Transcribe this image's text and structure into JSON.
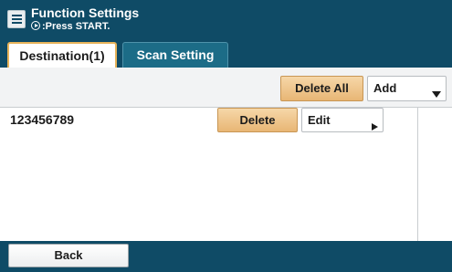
{
  "header": {
    "title": "Function Settings",
    "subtitle": ":Press START.",
    "menu_icon": "menu-icon",
    "start_icon": "start-icon"
  },
  "tabs": [
    {
      "label": "Destination(1)",
      "active": true
    },
    {
      "label": "Scan Setting",
      "active": false
    }
  ],
  "toolbar": {
    "delete_all_label": "Delete All",
    "add_label": "Add"
  },
  "list": {
    "rows": [
      {
        "number": "123456789",
        "delete_label": "Delete",
        "edit_label": "Edit"
      }
    ]
  },
  "footer": {
    "back_label": "Back"
  },
  "colors": {
    "header_bg": "#0f4b66",
    "accent_orange": "#e8b675",
    "tab_inactive": "#1c6c87"
  }
}
